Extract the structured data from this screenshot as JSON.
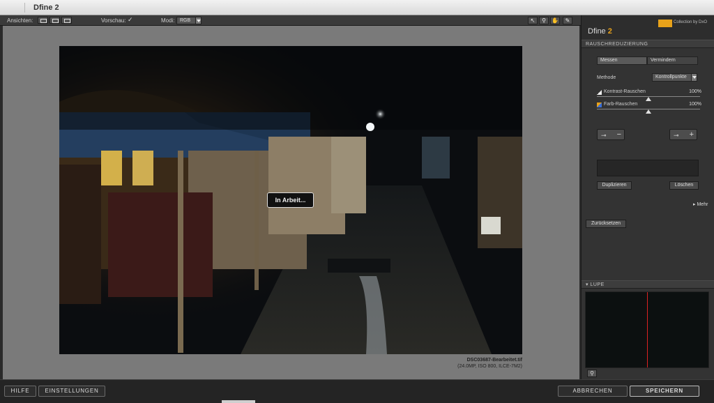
{
  "window": {
    "title": "Dfine 2"
  },
  "toolbar": {
    "views_label": "Ansichten:",
    "preview_label": "Vorschau:",
    "preview_checked": "✓",
    "mode_label": "Modi:",
    "mode_value": "RGB",
    "tools": [
      {
        "icon": "pointer-icon",
        "glyph": "↖"
      },
      {
        "icon": "zoom-icon",
        "glyph": "⚲"
      },
      {
        "icon": "hand-icon",
        "glyph": "✋"
      },
      {
        "icon": "eyedropper-icon",
        "glyph": "✎"
      }
    ]
  },
  "preview": {
    "status": "In Arbeit...",
    "file_name": "DSC03687-Bearbeitet.tif",
    "file_meta": "(24.0MP, ISO 800, ILCE-7M2)"
  },
  "panel": {
    "app_name_main": "Dfine",
    "app_name_version": "2",
    "brand": "Collection by DxO",
    "section_noise": "RAUSCHREDUZIERUNG",
    "tab_measure": "Messen",
    "tab_reduce": "Vermindern",
    "method_label": "Methode",
    "method_value": "Kontrollpunkte",
    "contrast_label": "Kontrast-Rauschen",
    "contrast_value": "100%",
    "contrast_fraction": 1.0,
    "color_label": "Farb-Rauschen",
    "color_value": "100%",
    "color_fraction": 1.0,
    "duplicate_label": "Duplizieren",
    "delete_label": "Löschen",
    "more_label": "Mehr",
    "reset_label": "Zurücksetzen",
    "section_loupe": "LUPE",
    "colors": {
      "accent": "#e8a21a",
      "loupe_line": "#dd2222"
    }
  },
  "bottom": {
    "help_label": "HILFE",
    "settings_label": "EINSTELLUNGEN",
    "cancel_label": "ABBRECHEN",
    "save_label": "SPEICHERN"
  }
}
